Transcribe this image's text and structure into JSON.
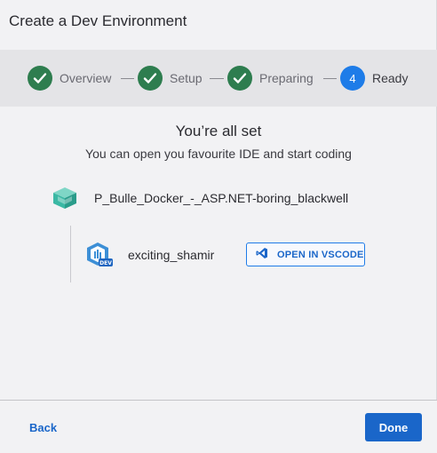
{
  "dialog": {
    "title": "Create a Dev Environment"
  },
  "stepper": {
    "steps": [
      {
        "label": "Overview",
        "state": "done"
      },
      {
        "label": "Setup",
        "state": "done"
      },
      {
        "label": "Preparing",
        "state": "done"
      },
      {
        "label": "Ready",
        "state": "active",
        "number": "4"
      }
    ]
  },
  "main": {
    "title": "You’re all set",
    "subtitle": "You can open you favourite IDE and start coding",
    "project": {
      "name": "P_Bulle_Docker_-_ASP.NET-boring_blackwell",
      "icon": "cube-icon"
    },
    "environment": {
      "name": "exciting_shamir",
      "icon": "dev-environment-icon",
      "badge": "DEV",
      "open_button": "OPEN IN VSCODE",
      "open_button_icon": "vscode-icon"
    }
  },
  "footer": {
    "back_label": "Back",
    "done_label": "Done"
  },
  "colors": {
    "accent": "#1a66c9",
    "step_done": "#2e7d4f",
    "step_active": "#1e7ce8",
    "teal_icon": "#3bb8a4"
  }
}
